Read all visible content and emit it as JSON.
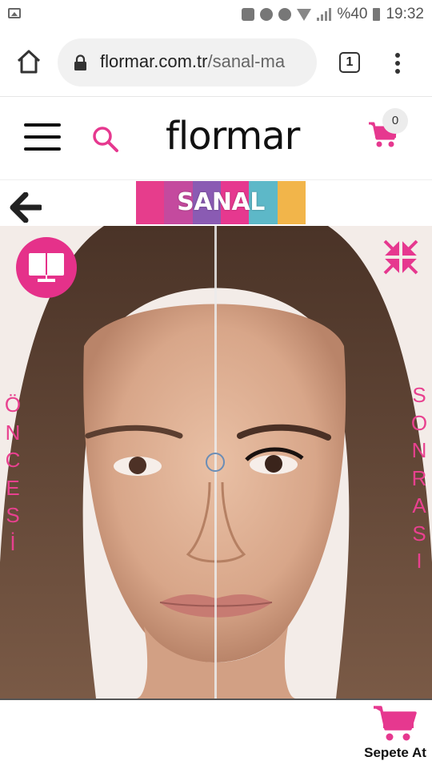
{
  "status_bar": {
    "battery": "%40",
    "time": "19:32"
  },
  "browser": {
    "url_domain": "flormar.com.tr",
    "url_path": "/sanal-ma",
    "tab_count": "1"
  },
  "header": {
    "logo": "flormar",
    "cart_count": "0",
    "accent_color": "#e6388f"
  },
  "banner": {
    "text": "SANAL MAKYAJ",
    "colors": [
      "#e63d8c",
      "#c44a9e",
      "#8a5bb3",
      "#e6388f",
      "#5db8c8",
      "#f2b54a"
    ]
  },
  "makeover": {
    "left_label": "ÖNCESİ",
    "right_label": "SONRASI"
  },
  "footer": {
    "add_to_cart_label": "Sepete At"
  }
}
